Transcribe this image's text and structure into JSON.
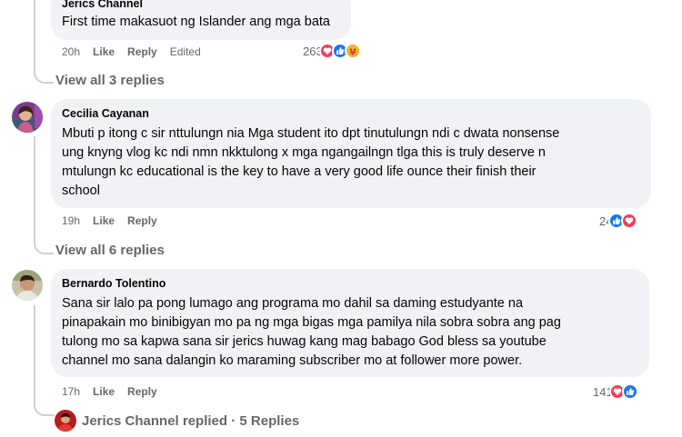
{
  "comment1": {
    "author": "Jerics Channel",
    "text": "First time makasuot ng Islander ang mga bata",
    "time": "20h",
    "like": "Like",
    "reply": "Reply",
    "edited": "Edited",
    "reaction_count": "263",
    "view_replies": "View all 3 replies"
  },
  "comment2": {
    "author": "Cecilia Cayanan",
    "lines": [
      "Mbuti p itong c sir nttulungn nia Mga student ito dpt tinutulungn ndi c dwata nonsense",
      "ung knyng vlog kc ndi nmn nkktulong x mga ngangailngn tlga this is truly deserve n",
      "mtulungn kc educational is the key to have a very good life ounce their finish their",
      "school"
    ],
    "time": "19h",
    "like": "Like",
    "reply": "Reply",
    "reaction_count": "24",
    "view_replies": "View all 6 replies"
  },
  "comment3": {
    "author": "Bernardo Tolentino",
    "lines": [
      "Sana sir lalo pa pong lumago ang programa mo dahil sa daming estudyante na",
      "pinapakain mo binibigyan mo pa ng mga bigas mga pamilya nila sobra sobra ang pag",
      "tulong mo sa kapwa sana sir jerics huwag kang mag babago God bless sa youtube",
      "channel mo sana dalangin ko maraming subscriber mo at follower more power."
    ],
    "time": "17h",
    "like": "Like",
    "reply": "Reply",
    "reaction_count": "141",
    "replied_text": "Jerics Channel replied · 5 Replies"
  },
  "colors": {
    "heart": "#f33e58",
    "like": "#1877f2",
    "care": "#f7b125",
    "bubble": "#f0f2f5"
  }
}
